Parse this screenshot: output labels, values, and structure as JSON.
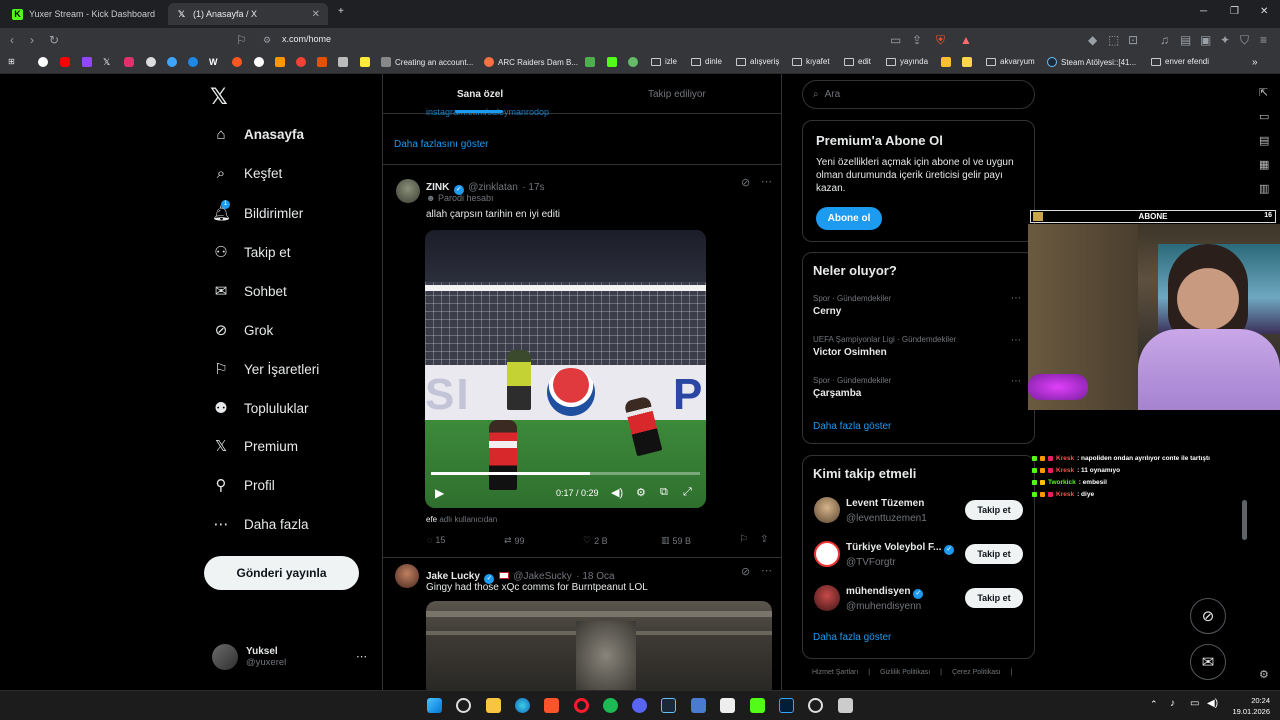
{
  "browser": {
    "tabs": [
      {
        "label": "Yuxer Stream - Kick Dashboard",
        "icon": "kick-icon"
      },
      {
        "label": "(1) Anasayfa / X",
        "icon": "x-icon"
      }
    ],
    "url": "x.com/home",
    "bookmarks": [
      "Creating an account...",
      "ARC Raiders Dam B...",
      "izle",
      "dinle",
      "alışveriş",
      "kıyafet",
      "edit",
      "yayında",
      "akvaryum",
      "Steam Atölyesi::[41...",
      "enver efendi"
    ],
    "notification_count": "1"
  },
  "x_nav": {
    "items": [
      {
        "label": "Anasayfa",
        "icon": "home-icon"
      },
      {
        "label": "Keşfet",
        "icon": "search-icon"
      },
      {
        "label": "Bildirimler",
        "icon": "bell-icon"
      },
      {
        "label": "Takip et",
        "icon": "add-user-icon"
      },
      {
        "label": "Sohbet",
        "icon": "mail-icon"
      },
      {
        "label": "Grok",
        "icon": "grok-icon"
      },
      {
        "label": "Yer İşaretleri",
        "icon": "bookmark-icon"
      },
      {
        "label": "Topluluklar",
        "icon": "communities-icon"
      },
      {
        "label": "Premium",
        "icon": "x-icon"
      },
      {
        "label": "Profil",
        "icon": "person-icon"
      },
      {
        "label": "Daha fazla",
        "icon": "more-icon"
      }
    ],
    "notification_badge": "1",
    "post_button": "Gönderi yayınla",
    "user": {
      "name": "Yuksel",
      "handle": "@yuxerel"
    }
  },
  "feed": {
    "tabs": [
      "Sana özel",
      "Takip ediliyor"
    ],
    "cut_text": "instagram.com/suleymanrodop",
    "show_more": "Daha fazlasını göster",
    "tweets": [
      {
        "name": "ZINK",
        "handle": "@zinklatan",
        "time": "· 17s",
        "label": "Parodi hesabı",
        "text": "allah çarpsın tarihin en iyi editi",
        "video_time": "0:17 / 0:29",
        "video_progress": 0.59,
        "attribution": "efe",
        "attribution_suffix": "adlı kullanıcıdan",
        "replies": "15",
        "reposts": "99",
        "likes": "2 B",
        "views": "59 B"
      },
      {
        "name": "Jake Lucky",
        "handle": "@JakeSucky",
        "time": "· 18 Oca",
        "text": "Gingy had those xQc comms for Burntpeanut LOL"
      }
    ]
  },
  "right": {
    "search_placeholder": "Ara",
    "premium": {
      "title": "Premium'a Abone Ol",
      "text": "Yeni özellikleri açmak için abone ol ve uygun olman durumunda içerik üreticisi gelir payı kazan.",
      "button": "Abone ol"
    },
    "trends": {
      "title": "Neler oluyor?",
      "items": [
        {
          "meta": "Spor · Gündemdekiler",
          "name": "Cerny"
        },
        {
          "meta": "UEFA Şampiyonlar Ligi · Gündemdekiler",
          "name": "Victor Osimhen"
        },
        {
          "meta": "Spor · Gündemdekiler",
          "name": "Çarşamba"
        }
      ],
      "more": "Daha fazla göster"
    },
    "who": {
      "title": "Kimi takip etmeli",
      "items": [
        {
          "name": "Levent Tüzemen",
          "handle": "@leventtuzemen1",
          "button": "Takip et"
        },
        {
          "name": "Türkiye Voleybol F...",
          "handle": "@TVForgtr",
          "button": "Takip et"
        },
        {
          "name": "mühendisyen",
          "handle": "@muhendisyenn",
          "button": "Takip et"
        }
      ],
      "more": "Daha fazla göster"
    },
    "footer": [
      "Hizmet Şartları",
      "Gizlilik Politikası",
      "Çerez Politikası"
    ]
  },
  "overlay": {
    "abone_label": "ABONE",
    "abone_count": "16",
    "chat": [
      {
        "user": "Kresk",
        "text": ": napoliden ondan ayrılıyor conte ile tartıştı",
        "color": "#ff4d4d"
      },
      {
        "user": "Kresk",
        "text": ": 11 oynamıyo",
        "color": "#ff4d4d"
      },
      {
        "user": "Tworkick",
        "text": ": embesil",
        "color": "#53fc18"
      },
      {
        "user": "Kresk",
        "text": ": diye",
        "color": "#ff4d4d"
      }
    ]
  },
  "taskbar": {
    "time": "20:24",
    "date": "19.01.2026"
  },
  "colors": {
    "accent": "#1d9bf0",
    "background": "#000000",
    "kick_green": "#53fc18"
  }
}
